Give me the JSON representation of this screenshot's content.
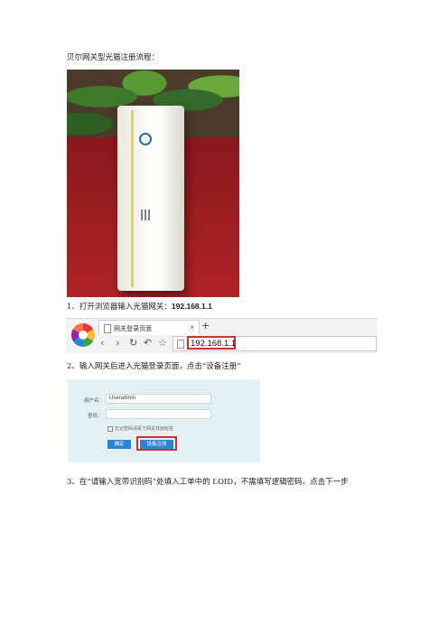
{
  "doc": {
    "title": "贝尔网关型光猫注册流程：",
    "step1": "1、打开浏览器输入光猫网关：",
    "step1_ip": "192.168.1.1",
    "step2": "2、输入网关后进入光猫登录页面，点击“设备注册”",
    "step3": "3、在“请输入宽带识别码”处填入工单中的 LOID，不需填写逻辑密码。点击下一步"
  },
  "browser": {
    "tab_title": "网关登录页面",
    "tab_close": "×",
    "new_tab": "+",
    "address": "192.168.1.1",
    "icons": [
      "back-icon",
      "forward-icon",
      "reload-icon",
      "undo-icon",
      "star-icon"
    ]
  },
  "login": {
    "username_label": "用户名：",
    "username_value": "Useradmin",
    "password_label": "密码：",
    "password_value": "",
    "hint": "忘记密码请看下网关背面标签",
    "confirm_button": "确定",
    "register_button": "设备注册"
  },
  "colors": {
    "highlight": "#d32f2f",
    "button": "#2c84d4",
    "panel": "#e3f1f4"
  }
}
